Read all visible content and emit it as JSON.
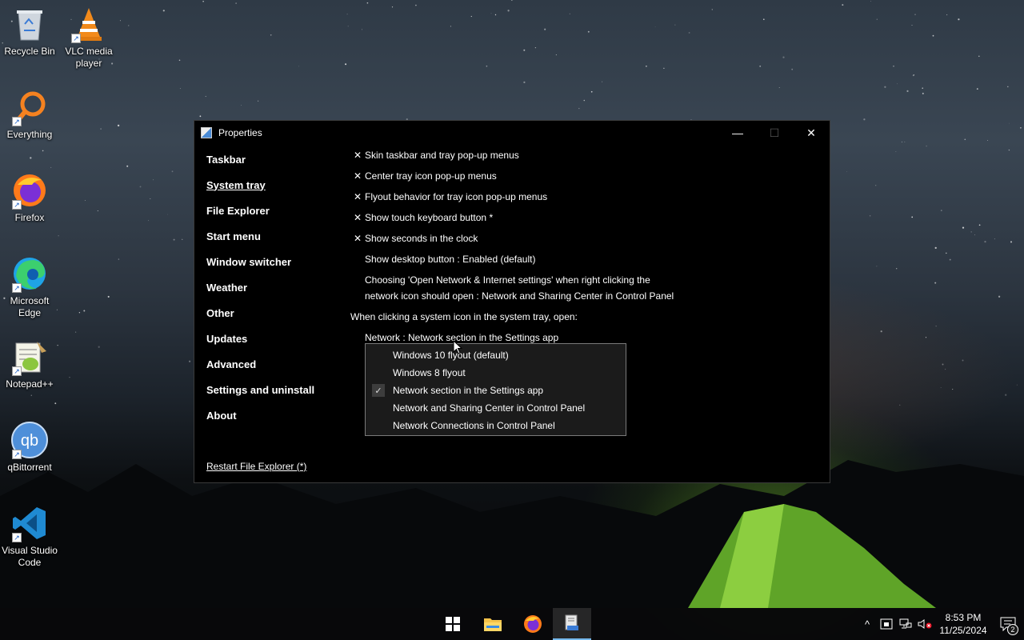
{
  "desktop": {
    "icons": [
      {
        "label": "Recycle Bin"
      },
      {
        "label": "VLC media player"
      },
      {
        "label": "Everything"
      },
      {
        "label": "Firefox"
      },
      {
        "label": "Microsoft Edge"
      },
      {
        "label": "Notepad++"
      },
      {
        "label": "qBittorrent"
      },
      {
        "label": "Visual Studio Code"
      }
    ]
  },
  "window": {
    "title": "Properties",
    "controls": {
      "minimize": "—",
      "maximize": "☐",
      "close": "✕"
    },
    "nav": [
      {
        "label": "Taskbar"
      },
      {
        "label": "System tray",
        "active": true
      },
      {
        "label": "File Explorer"
      },
      {
        "label": "Start menu"
      },
      {
        "label": "Window switcher"
      },
      {
        "label": "Weather"
      },
      {
        "label": "Other"
      },
      {
        "label": "Updates"
      },
      {
        "label": "Advanced"
      },
      {
        "label": "Settings and uninstall"
      },
      {
        "label": "About"
      }
    ],
    "restart_link": "Restart File Explorer (*)",
    "options": [
      {
        "check": "✕",
        "label": "Skin taskbar and tray pop-up menus"
      },
      {
        "check": "✕",
        "label": "Center tray icon pop-up menus"
      },
      {
        "check": "✕",
        "label": "Flyout behavior for tray icon pop-up menus"
      },
      {
        "check": "✕",
        "label": "Show touch keyboard button *"
      },
      {
        "check": "✕",
        "label": "Show seconds in the clock"
      },
      {
        "label": "Show desktop button : Enabled (default)"
      },
      {
        "line1": "Choosing 'Open Network & Internet settings' when right clicking the",
        "line2": "network icon should open : Network and Sharing Center in Control Panel"
      }
    ],
    "section_heading": "When clicking a system icon in the system tray, open:",
    "network_setting": "Network : Network section in the Settings app",
    "dropdown": {
      "items": [
        {
          "label": "Windows 10 flyout (default)",
          "checked": false
        },
        {
          "label": "Windows 8 flyout",
          "checked": false
        },
        {
          "label": "Network section in the Settings app",
          "checked": true
        },
        {
          "label": "Network and Sharing Center in Control Panel",
          "checked": false
        },
        {
          "label": "Network Connections in Control Panel",
          "checked": false
        }
      ],
      "check_glyph": "✓"
    }
  },
  "taskbar": {
    "buttons": [
      "start-icon",
      "file-explorer-icon",
      "firefox-icon",
      "properties-app-icon"
    ],
    "tray": {
      "chevron": "^",
      "time": "8:53 PM",
      "date": "11/25/2024",
      "notification_count": "2"
    }
  }
}
